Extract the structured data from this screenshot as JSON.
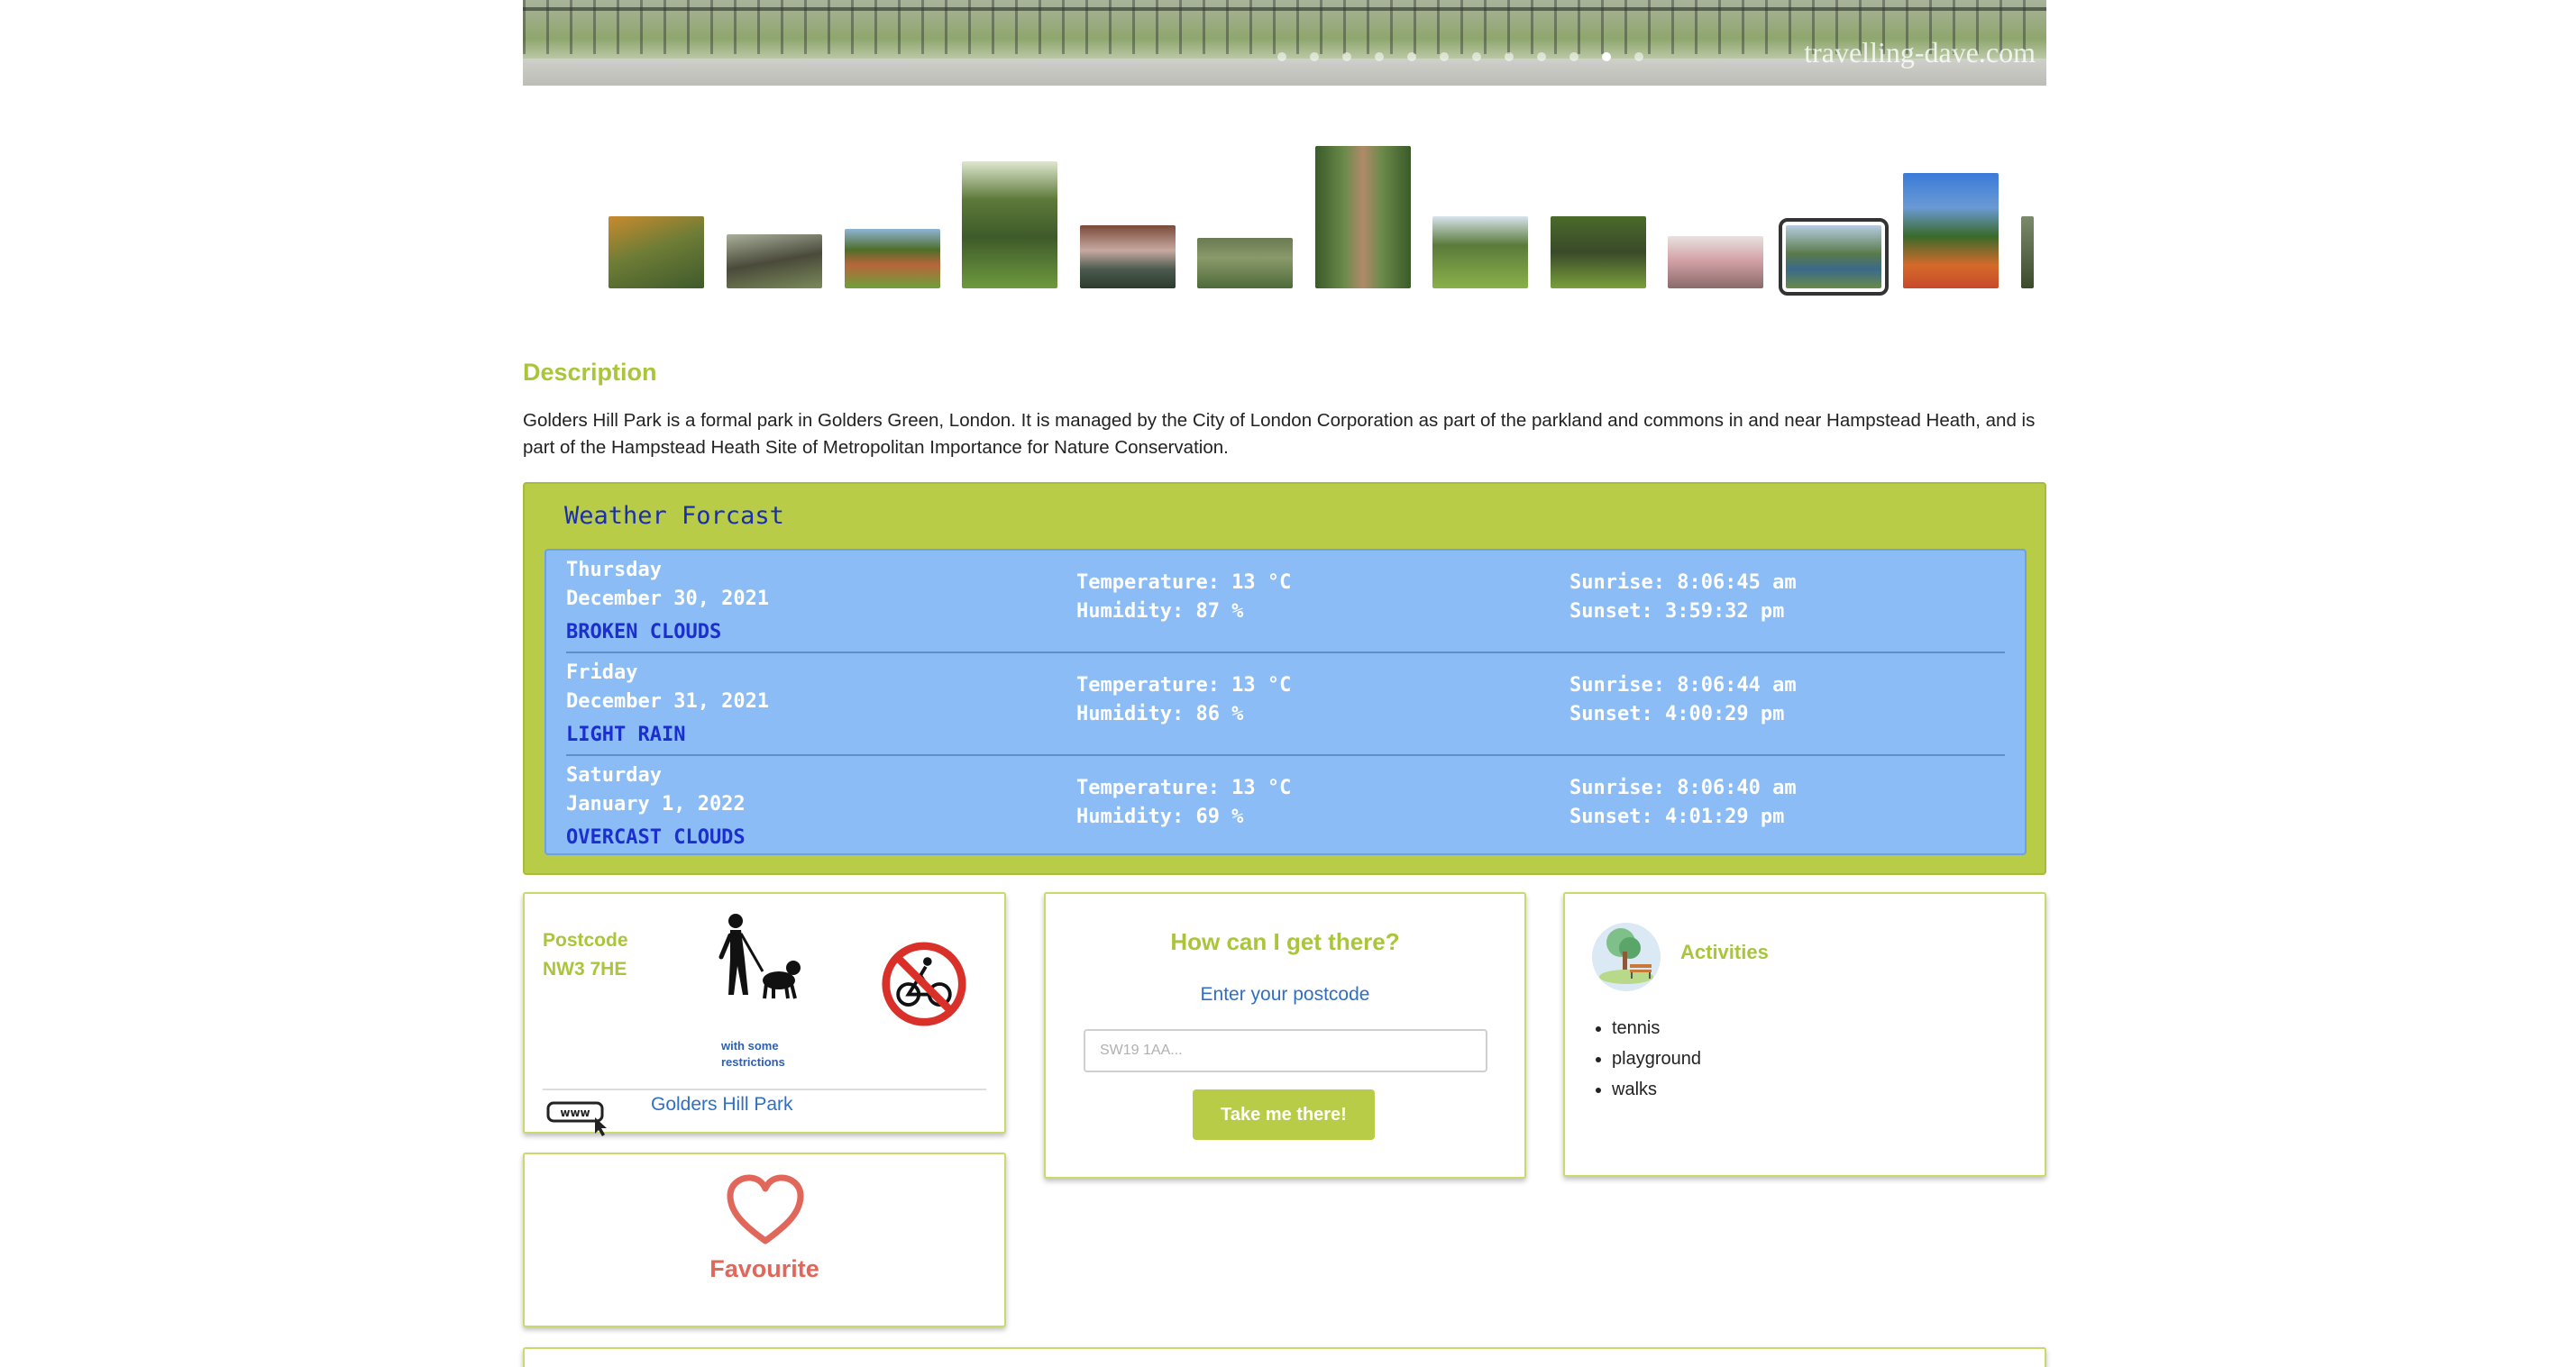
{
  "hero": {
    "watermark": "travelling-dave.com",
    "slide_count": 12,
    "active_slide": 10
  },
  "gallery": {
    "selected_index": 10,
    "thumbnails": [
      {
        "name": "thumb-autumn-pond"
      },
      {
        "name": "thumb-fallen-tree"
      },
      {
        "name": "thumb-lawn-trees"
      },
      {
        "name": "thumb-gazebo"
      },
      {
        "name": "thumb-reflections"
      },
      {
        "name": "thumb-garden-beds"
      },
      {
        "name": "thumb-pergola-walk"
      },
      {
        "name": "thumb-park-lawn"
      },
      {
        "name": "thumb-emu"
      },
      {
        "name": "thumb-blossom-tree"
      },
      {
        "name": "thumb-pond-view"
      },
      {
        "name": "thumb-flower-garden"
      },
      {
        "name": "thumb-partial"
      }
    ]
  },
  "description": {
    "title": "Description",
    "text": "Golders Hill Park is a formal park in Golders Green, London. It is managed by the City of London Corporation as part of the parkland and commons in and near Hampstead Heath, and is part of the Hampstead Heath Site of Metropolitan Importance for Nature Conservation."
  },
  "weather": {
    "title": "Weather Forcast",
    "days": [
      {
        "day": "Thursday",
        "date": "December 30, 2021",
        "condition": "BROKEN CLOUDS",
        "temperature": "Temperature: 13 °C",
        "humidity": "Humidity: 87 %",
        "sunrise": "Sunrise: 8:06:45 am",
        "sunset": "Sunset: 3:59:32 pm"
      },
      {
        "day": "Friday",
        "date": "December 31, 2021",
        "condition": "LIGHT RAIN",
        "temperature": "Temperature: 13 °C",
        "humidity": "Humidity: 86 %",
        "sunrise": "Sunrise: 8:06:44 am",
        "sunset": "Sunset: 4:00:29 pm"
      },
      {
        "day": "Saturday",
        "date": "January 1, 2022",
        "condition": "OVERCAST CLOUDS",
        "temperature": "Temperature: 13 °C",
        "humidity": "Humidity: 69 %",
        "sunrise": "Sunrise: 8:06:40 am",
        "sunset": "Sunset: 4:01:29 pm"
      }
    ]
  },
  "info_card": {
    "postcode_label": "Postcode",
    "postcode_value": "NW3 7HE",
    "dogs_note_line1": "with some",
    "dogs_note_line2": "restrictions",
    "park_link": "Golders Hill Park",
    "icons": [
      "dog-walking-icon",
      "no-cycling-icon",
      "www-link-icon"
    ]
  },
  "directions": {
    "title": "How can I get there?",
    "subtitle": "Enter your postcode",
    "placeholder": "SW19 1AA...",
    "button": "Take me there!"
  },
  "activities": {
    "title": "Activities",
    "items": [
      "tennis",
      "playground",
      "walks"
    ],
    "icon": "park-bench-tree-icon"
  },
  "favourite": {
    "label": "Favourite",
    "icon": "heart-icon",
    "color": "#e0675a"
  },
  "colors": {
    "accent_green": "#b9cc47",
    "weather_blue": "#8bbcf5",
    "condition_blue": "#1b2fd0",
    "link_blue": "#2f6fc4"
  }
}
